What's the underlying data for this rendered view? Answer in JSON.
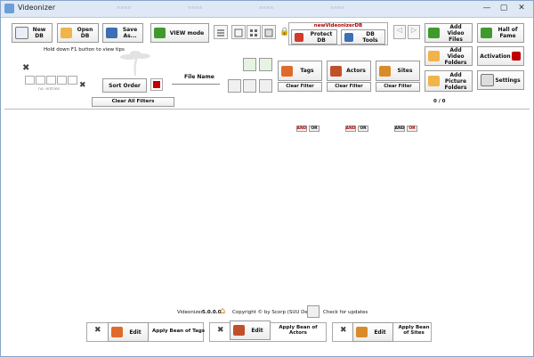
{
  "window": {
    "title": "Videonizer",
    "minimize": "—",
    "maximize": "▢",
    "close": "✕"
  },
  "toolbar": {
    "new_db": "New DB",
    "open_db": "Open DB",
    "save_as": "Save As...",
    "view_mode": "VIEW mode",
    "db_name": "newVideonizerDB",
    "protect_db": "Protect DB",
    "db_tools": "DB Tools",
    "add_video_files": "Add Video Files",
    "hall_of_fame": "Hall of Fame",
    "add_video_folders": "Add Video Folders",
    "activation": "Activation",
    "add_picture_folders": "Add Picture Folders",
    "settings": "Settings"
  },
  "hint": "Hold down F1 button to view tips",
  "pager_label": "no. entries",
  "sort_order": "Sort Order",
  "file_name": "File Name",
  "clear_all_filters": "Clear All Filters",
  "filters": {
    "and": "AND",
    "or": "OR",
    "tags": "Tags",
    "actors": "Actors",
    "sites": "Sites",
    "clear_filter": "Clear Filter"
  },
  "count": "0 / 0",
  "footer": {
    "app": "Videonizer",
    "version": "5.0.0.0",
    "copyright": "Copyright © by Scorp (SUU Design)",
    "check_updates": "Check for updates"
  },
  "bottom": {
    "edit": "Edit",
    "apply_tags": "Apply Bean of Tags",
    "apply_actors": "Apply Bean of Actors",
    "apply_sites": "Apply Bean of Sites"
  },
  "colors": {
    "accent": "#c00000",
    "folder": "#f0b44a",
    "green": "#3f9a2e",
    "blue": "#3c6fb3"
  }
}
